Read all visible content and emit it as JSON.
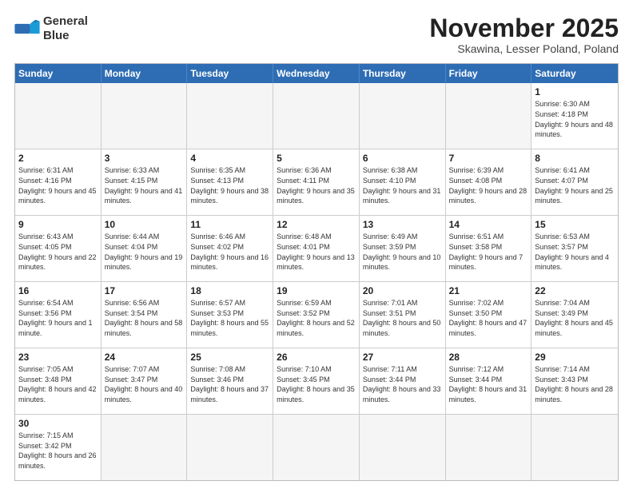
{
  "logo": {
    "line1": "General",
    "line2": "Blue"
  },
  "title": "November 2025",
  "subtitle": "Skawina, Lesser Poland, Poland",
  "days_of_week": [
    "Sunday",
    "Monday",
    "Tuesday",
    "Wednesday",
    "Thursday",
    "Friday",
    "Saturday"
  ],
  "weeks": [
    [
      {
        "day": "",
        "empty": true
      },
      {
        "day": "",
        "empty": true
      },
      {
        "day": "",
        "empty": true
      },
      {
        "day": "",
        "empty": true
      },
      {
        "day": "",
        "empty": true
      },
      {
        "day": "",
        "empty": true
      },
      {
        "day": "1",
        "sunrise": "6:30 AM",
        "sunset": "4:18 PM",
        "daylight": "9 hours and 48 minutes."
      }
    ],
    [
      {
        "day": "2",
        "sunrise": "6:31 AM",
        "sunset": "4:16 PM",
        "daylight": "9 hours and 45 minutes."
      },
      {
        "day": "3",
        "sunrise": "6:33 AM",
        "sunset": "4:15 PM",
        "daylight": "9 hours and 41 minutes."
      },
      {
        "day": "4",
        "sunrise": "6:35 AM",
        "sunset": "4:13 PM",
        "daylight": "9 hours and 38 minutes."
      },
      {
        "day": "5",
        "sunrise": "6:36 AM",
        "sunset": "4:11 PM",
        "daylight": "9 hours and 35 minutes."
      },
      {
        "day": "6",
        "sunrise": "6:38 AM",
        "sunset": "4:10 PM",
        "daylight": "9 hours and 31 minutes."
      },
      {
        "day": "7",
        "sunrise": "6:39 AM",
        "sunset": "4:08 PM",
        "daylight": "9 hours and 28 minutes."
      },
      {
        "day": "8",
        "sunrise": "6:41 AM",
        "sunset": "4:07 PM",
        "daylight": "9 hours and 25 minutes."
      }
    ],
    [
      {
        "day": "9",
        "sunrise": "6:43 AM",
        "sunset": "4:05 PM",
        "daylight": "9 hours and 22 minutes."
      },
      {
        "day": "10",
        "sunrise": "6:44 AM",
        "sunset": "4:04 PM",
        "daylight": "9 hours and 19 minutes."
      },
      {
        "day": "11",
        "sunrise": "6:46 AM",
        "sunset": "4:02 PM",
        "daylight": "9 hours and 16 minutes."
      },
      {
        "day": "12",
        "sunrise": "6:48 AM",
        "sunset": "4:01 PM",
        "daylight": "9 hours and 13 minutes."
      },
      {
        "day": "13",
        "sunrise": "6:49 AM",
        "sunset": "3:59 PM",
        "daylight": "9 hours and 10 minutes."
      },
      {
        "day": "14",
        "sunrise": "6:51 AM",
        "sunset": "3:58 PM",
        "daylight": "9 hours and 7 minutes."
      },
      {
        "day": "15",
        "sunrise": "6:53 AM",
        "sunset": "3:57 PM",
        "daylight": "9 hours and 4 minutes."
      }
    ],
    [
      {
        "day": "16",
        "sunrise": "6:54 AM",
        "sunset": "3:56 PM",
        "daylight": "9 hours and 1 minute."
      },
      {
        "day": "17",
        "sunrise": "6:56 AM",
        "sunset": "3:54 PM",
        "daylight": "8 hours and 58 minutes."
      },
      {
        "day": "18",
        "sunrise": "6:57 AM",
        "sunset": "3:53 PM",
        "daylight": "8 hours and 55 minutes."
      },
      {
        "day": "19",
        "sunrise": "6:59 AM",
        "sunset": "3:52 PM",
        "daylight": "8 hours and 52 minutes."
      },
      {
        "day": "20",
        "sunrise": "7:01 AM",
        "sunset": "3:51 PM",
        "daylight": "8 hours and 50 minutes."
      },
      {
        "day": "21",
        "sunrise": "7:02 AM",
        "sunset": "3:50 PM",
        "daylight": "8 hours and 47 minutes."
      },
      {
        "day": "22",
        "sunrise": "7:04 AM",
        "sunset": "3:49 PM",
        "daylight": "8 hours and 45 minutes."
      }
    ],
    [
      {
        "day": "23",
        "sunrise": "7:05 AM",
        "sunset": "3:48 PM",
        "daylight": "8 hours and 42 minutes."
      },
      {
        "day": "24",
        "sunrise": "7:07 AM",
        "sunset": "3:47 PM",
        "daylight": "8 hours and 40 minutes."
      },
      {
        "day": "25",
        "sunrise": "7:08 AM",
        "sunset": "3:46 PM",
        "daylight": "8 hours and 37 minutes."
      },
      {
        "day": "26",
        "sunrise": "7:10 AM",
        "sunset": "3:45 PM",
        "daylight": "8 hours and 35 minutes."
      },
      {
        "day": "27",
        "sunrise": "7:11 AM",
        "sunset": "3:44 PM",
        "daylight": "8 hours and 33 minutes."
      },
      {
        "day": "28",
        "sunrise": "7:12 AM",
        "sunset": "3:44 PM",
        "daylight": "8 hours and 31 minutes."
      },
      {
        "day": "29",
        "sunrise": "7:14 AM",
        "sunset": "3:43 PM",
        "daylight": "8 hours and 28 minutes."
      }
    ],
    [
      {
        "day": "30",
        "sunrise": "7:15 AM",
        "sunset": "3:42 PM",
        "daylight": "8 hours and 26 minutes."
      },
      {
        "day": "",
        "empty": true
      },
      {
        "day": "",
        "empty": true
      },
      {
        "day": "",
        "empty": true
      },
      {
        "day": "",
        "empty": true
      },
      {
        "day": "",
        "empty": true
      },
      {
        "day": "",
        "empty": true
      }
    ]
  ]
}
